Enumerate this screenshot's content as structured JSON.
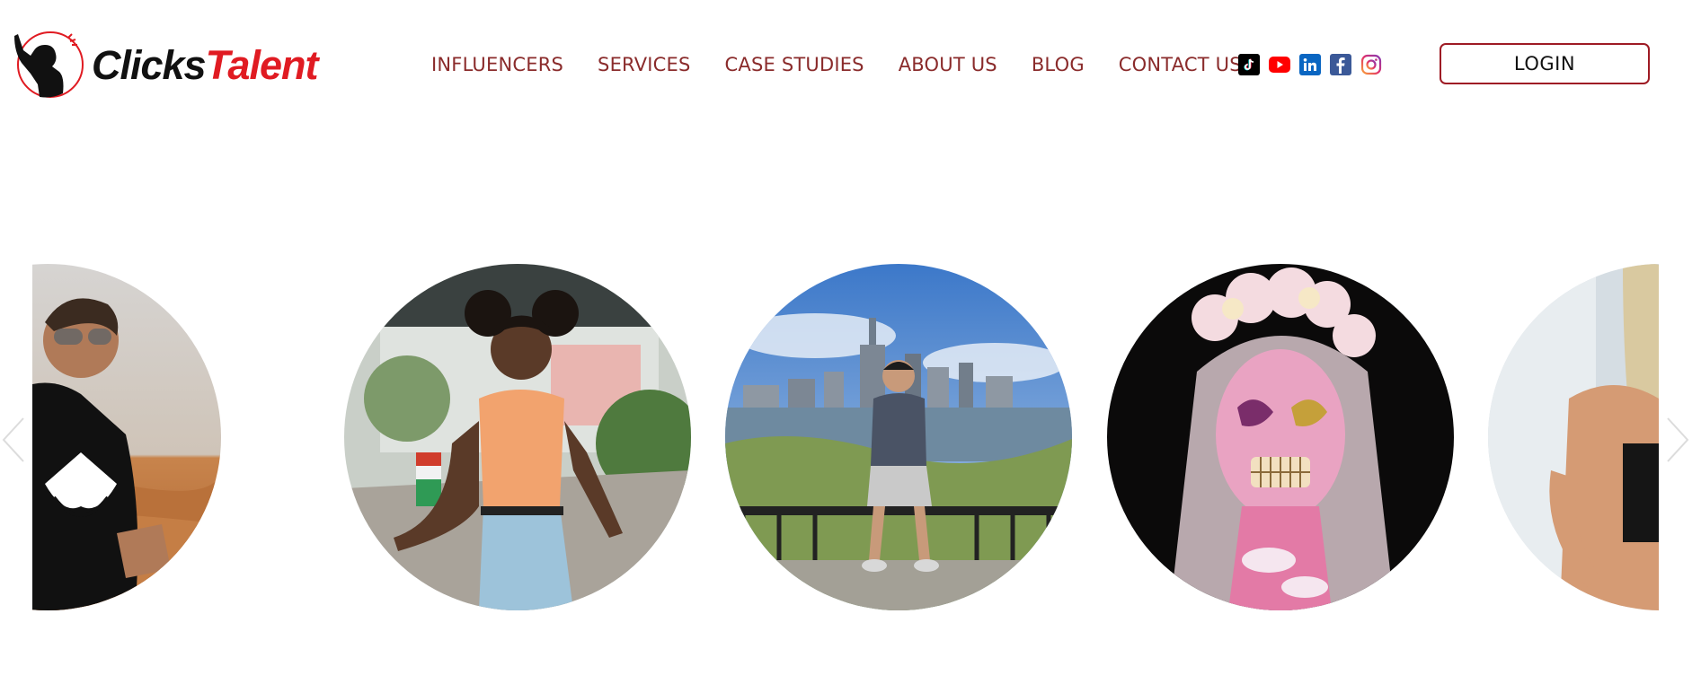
{
  "brand": {
    "name_part1": "Clicks",
    "name_part2": "Talent",
    "accent": "#e01b22"
  },
  "nav": {
    "items": [
      {
        "label": "INFLUENCERS"
      },
      {
        "label": "SERVICES"
      },
      {
        "label": "CASE STUDIES"
      },
      {
        "label": "ABOUT US"
      },
      {
        "label": "BLOG"
      },
      {
        "label": "CONTACT US"
      }
    ],
    "color": "#8a2b2b"
  },
  "socials": [
    {
      "icon": "tiktok-icon"
    },
    {
      "icon": "youtube-icon"
    },
    {
      "icon": "linkedin-icon"
    },
    {
      "icon": "facebook-icon"
    },
    {
      "icon": "instagram-icon"
    }
  ],
  "login": {
    "label": "LOGIN",
    "border_color": "#9e1b24"
  },
  "carousel": {
    "prev_icon": "chevron-left-icon",
    "next_icon": "chevron-right-icon",
    "slides": [
      {
        "name": "influencer-desert"
      },
      {
        "name": "influencer-patio"
      },
      {
        "name": "influencer-skyline"
      },
      {
        "name": "influencer-facepaint"
      },
      {
        "name": "influencer-blonde"
      }
    ]
  }
}
